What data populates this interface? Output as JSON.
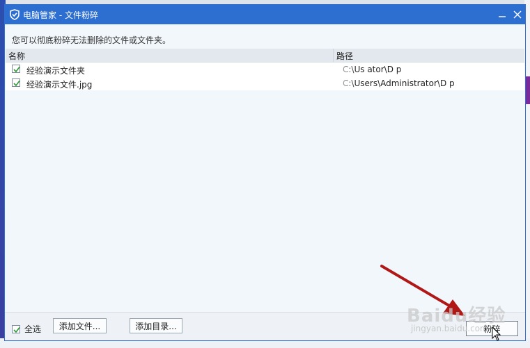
{
  "window": {
    "title": "电脑管家 - 文件粉碎",
    "minimize_icon": "minimize-icon",
    "close_icon": "close-icon"
  },
  "hint": "您可以彻底粉碎无法删除的文件或文件夹。",
  "list": {
    "columns": {
      "name": "名称",
      "path": "路径"
    },
    "rows": [
      {
        "checked": true,
        "name": "经验演示文件夹",
        "path": "C:\\Us            ator\\D        p"
      },
      {
        "checked": true,
        "name": "经验演示文件.jpg",
        "path": "C:\\Users\\Administrator\\D       p"
      }
    ]
  },
  "footer": {
    "select_all_checked": true,
    "select_all_label": "全选",
    "add_file_label": "添加文件...",
    "add_dir_label": "添加目录...",
    "shred_label": "粉碎"
  },
  "watermark": {
    "main": "Baidu经验",
    "sub": "jingyan.baidu.com"
  },
  "colors": {
    "titlebar": "#2d6fd1",
    "dialog_bg": "#f2f7fc",
    "checkmark": "#2e9b3a",
    "annotation_arrow": "#b01818"
  }
}
